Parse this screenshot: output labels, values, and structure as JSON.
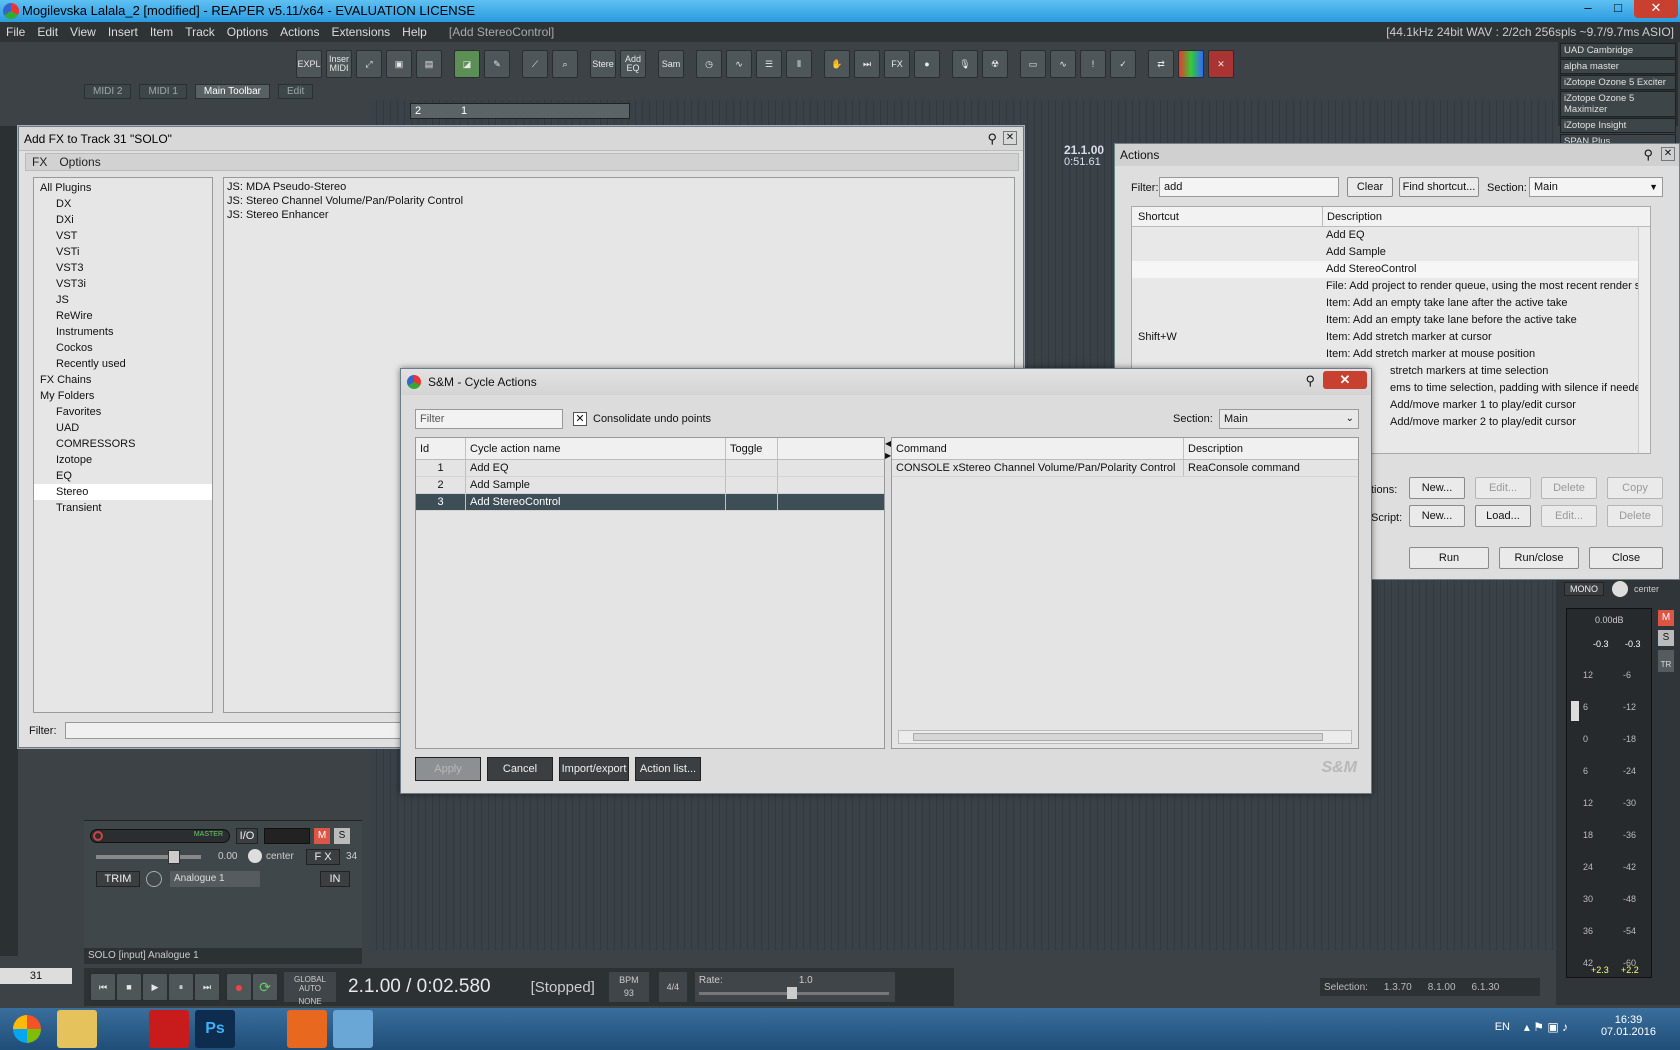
{
  "window": {
    "title": "Mogilevska Lalala_2 [modified] - REAPER v5.11/x64 - EVALUATION LICENSE",
    "min": "–",
    "max": "□",
    "close": "✕"
  },
  "menubar": {
    "items": [
      "File",
      "Edit",
      "View",
      "Insert",
      "Item",
      "Track",
      "Options",
      "Actions",
      "Extensions",
      "Help"
    ],
    "last_action": "[Add StereoControl]",
    "audio_info": "[44.1kHz 24bit WAV : 2/2ch 256spls ~9.7/9.7ms ASIO]"
  },
  "toolbar": {
    "buttons": [
      "EXPL",
      "Inser MIDI",
      "",
      "",
      "",
      "",
      "",
      "",
      "",
      "Stere",
      "Add EQ",
      "Sam",
      "",
      "",
      "",
      "",
      "",
      "",
      "",
      "FX",
      "",
      "",
      "",
      "",
      "",
      "",
      "",
      "",
      "",
      ""
    ]
  },
  "plugin_list": [
    "UAD Cambridge",
    "alpha master",
    "iZotope Ozone 5 Exciter",
    "iZotope Ozone 5 Maximizer",
    "iZotope Insight",
    "SPAN Plus"
  ],
  "tabs": [
    {
      "label": "MIDI 2"
    },
    {
      "label": "MIDI 1"
    },
    {
      "label": "Main Toolbar"
    },
    {
      "label": "Edit"
    }
  ],
  "ruler": {
    "m1": "2",
    "m2": "1"
  },
  "timecode": {
    "bars": "21.1.00",
    "time": "0:51.61"
  },
  "fx_dialog": {
    "title": "Add FX to Track 31 \"SOLO\"",
    "menu": [
      "FX",
      "Options"
    ],
    "tree": [
      {
        "label": "All Plugins",
        "indent": 0
      },
      {
        "label": "DX",
        "indent": 1
      },
      {
        "label": "DXi",
        "indent": 1
      },
      {
        "label": "VST",
        "indent": 1
      },
      {
        "label": "VSTi",
        "indent": 1
      },
      {
        "label": "VST3",
        "indent": 1
      },
      {
        "label": "VST3i",
        "indent": 1
      },
      {
        "label": "JS",
        "indent": 1
      },
      {
        "label": "ReWire",
        "indent": 1
      },
      {
        "label": "Instruments",
        "indent": 1
      },
      {
        "label": "Cockos",
        "indent": 1
      },
      {
        "label": "Recently used",
        "indent": 1
      },
      {
        "label": "FX Chains",
        "indent": 0
      },
      {
        "label": "My Folders",
        "indent": 0
      },
      {
        "label": "Favorites",
        "indent": 1
      },
      {
        "label": "UAD",
        "indent": 1
      },
      {
        "label": "COMRESSORS",
        "indent": 1
      },
      {
        "label": "Izotope",
        "indent": 1
      },
      {
        "label": "EQ",
        "indent": 1
      },
      {
        "label": "Stereo",
        "indent": 1
      },
      {
        "label": "Transient",
        "indent": 1
      }
    ],
    "plugins": [
      "JS: MDA Pseudo-Stereo",
      "JS: Stereo Channel Volume/Pan/Polarity Control",
      "JS: Stereo Enhancer"
    ],
    "filter_label": "Filter:"
  },
  "actions_dialog": {
    "title": "Actions",
    "filter_label": "Filter:",
    "filter_value": "add",
    "clear": "Clear",
    "find_shortcut": "Find shortcut...",
    "section_label": "Section:",
    "section_value": "Main",
    "col_shortcut": "Shortcut",
    "col_description": "Description",
    "rows": [
      {
        "shortcut": "",
        "desc": "Add EQ"
      },
      {
        "shortcut": "",
        "desc": "Add Sample"
      },
      {
        "shortcut": "",
        "desc": "Add StereoControl"
      },
      {
        "shortcut": "",
        "desc": "File: Add project to render queue, using the most recent render setti"
      },
      {
        "shortcut": "",
        "desc": "Item: Add an empty take lane after the active take"
      },
      {
        "shortcut": "",
        "desc": "Item: Add an empty take lane before the active take"
      },
      {
        "shortcut": "Shift+W",
        "desc": "Item: Add stretch marker at cursor"
      },
      {
        "shortcut": "",
        "desc": "Item: Add stretch marker at mouse position"
      },
      {
        "shortcut": "",
        "desc": "stretch markers at time selection"
      },
      {
        "shortcut": "",
        "desc": "ems to time selection, padding with silence if needed"
      },
      {
        "shortcut": "",
        "desc": "Add/move marker 1 to play/edit cursor"
      },
      {
        "shortcut": "",
        "desc": "Add/move marker 2 to play/edit cursor"
      }
    ],
    "custom_label": "tions:",
    "script_label": "Script:",
    "row1": [
      "New...",
      "Edit...",
      "Delete",
      "Copy"
    ],
    "row2": [
      "New...",
      "Load...",
      "Edit...",
      "Delete"
    ],
    "run": "Run",
    "run_close": "Run/close",
    "close": "Close"
  },
  "cycle_dialog": {
    "title": "S&M - Cycle Actions",
    "filter_placeholder": "Filter",
    "consolidate": "Consolidate undo points",
    "section_label": "Section:",
    "section_value": "Main",
    "cols": {
      "id": "Id",
      "name": "Cycle action name",
      "toggle": "Toggle"
    },
    "rows": [
      {
        "id": "1",
        "name": "Add EQ",
        "toggle": ""
      },
      {
        "id": "2",
        "name": "Add Sample",
        "toggle": ""
      },
      {
        "id": "3",
        "name": "Add StereoControl",
        "toggle": ""
      }
    ],
    "cmd_cols": {
      "command": "Command",
      "description": "Description"
    },
    "cmd_rows": [
      {
        "command": "CONSOLE xStereo Channel Volume/Pan/Polarity Control",
        "description": "ReaConsole command"
      }
    ],
    "apply": "Apply",
    "cancel": "Cancel",
    "import_export": "Import/export",
    "action_list": "Action list...",
    "logo": "S&M"
  },
  "track": {
    "master_label": "MASTER",
    "io": "I/O",
    "m": "M",
    "s": "S",
    "vol": "0.00",
    "pan": "center",
    "fx": "F X",
    "num": "34",
    "trim": "TRIM",
    "input": "Analogue 1",
    "in_label": "IN",
    "status": "SOLO [input] Analogue 1",
    "track_no": "31"
  },
  "transport": {
    "global_auto": "GLOBAL AUTO",
    "none": "NONE",
    "position": "2.1.00 / 0:02.580",
    "state": "[Stopped]",
    "bpm_label": "BPM",
    "bpm": "93",
    "sig": "4/4",
    "rate_label": "Rate:",
    "rate": "1.0",
    "selection_label": "Selection:",
    "sel_start": "1.3.70",
    "sel_end": "8.1.00",
    "sel_len": "6.1.30"
  },
  "master": {
    "mono": "MONO",
    "pan": "center",
    "vol": "0.00dB",
    "peakL": "-0.3",
    "peakR": "-0.3",
    "m": "M",
    "s": "S",
    "tr": "TR",
    "scaleL": [
      "12",
      "6",
      "0",
      "6",
      "12",
      "18",
      "24",
      "30",
      "36",
      "42"
    ],
    "scaleR": [
      "-6",
      "-12",
      "-18",
      "-24",
      "-30",
      "-36",
      "-42",
      "-48",
      "-54",
      "-60"
    ],
    "lufsL": "+2.3",
    "lufsR": "+2.2"
  },
  "taskbar": {
    "lang": "EN",
    "time": "16:39",
    "date": "07.01.2016",
    "apps": [
      "",
      "",
      "",
      "Ps",
      "",
      "",
      ""
    ]
  }
}
